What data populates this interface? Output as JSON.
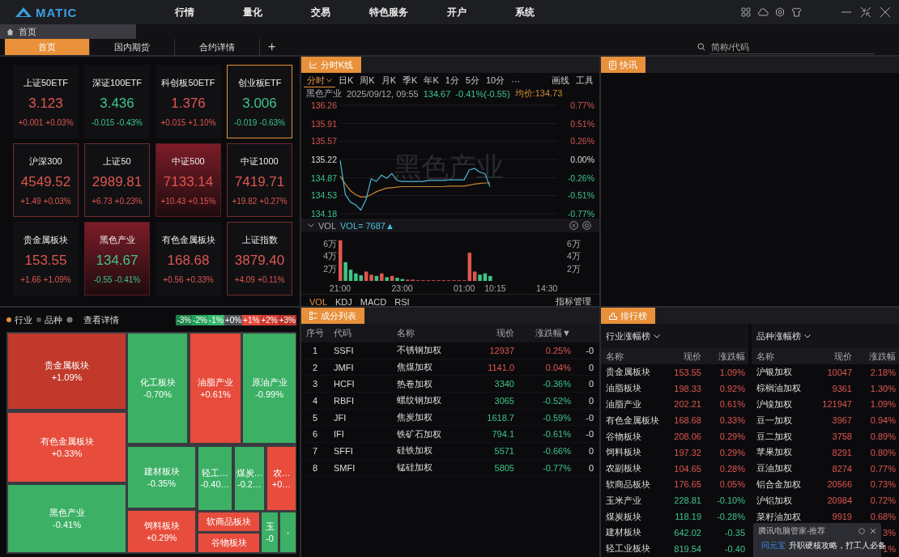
{
  "app": {
    "logo": "MATIC",
    "nav": [
      "行情",
      "量化",
      "交易",
      "特色服务",
      "开户",
      "系统"
    ]
  },
  "breadcrumb": {
    "label": "首页"
  },
  "tabs": [
    {
      "label": "首页",
      "selected": true
    },
    {
      "label": "国内期货",
      "selected": false
    },
    {
      "label": "合约详情",
      "selected": false
    }
  ],
  "add_tab": "+",
  "search": {
    "placeholder": "简称/代码"
  },
  "tiles": [
    {
      "name": "上证50ETF",
      "value": "3.123",
      "change": "+0.001",
      "pct": "+0.03%",
      "rising": true,
      "kind": "plain",
      "selected": false
    },
    {
      "name": "深证100ETF",
      "value": "3.436",
      "change": "-0.015",
      "pct": "-0.43%",
      "rising": false,
      "kind": "plain",
      "selected": false
    },
    {
      "name": "科创板50ETF",
      "value": "1.376",
      "change": "+0.015",
      "pct": "+1.10%",
      "rising": true,
      "kind": "plain",
      "selected": false
    },
    {
      "name": "创业板ETF",
      "value": "3.006",
      "change": "-0.019",
      "pct": "-0.63%",
      "rising": false,
      "kind": "plain",
      "selected": true
    },
    {
      "name": "沪深300",
      "value": "4549.52",
      "change": "+1.49",
      "pct": "+0.03%",
      "rising": true,
      "kind": "outlined",
      "selected": false
    },
    {
      "name": "上证50",
      "value": "2989.81",
      "change": "+6.73",
      "pct": "+0.23%",
      "rising": true,
      "kind": "outlined",
      "selected": false
    },
    {
      "name": "中证500",
      "value": "7133.14",
      "change": "+10.43",
      "pct": "+0.15%",
      "rising": true,
      "kind": "filled",
      "selected": false
    },
    {
      "name": "中证1000",
      "value": "7419.71",
      "change": "+19.82",
      "pct": "+0.27%",
      "rising": true,
      "kind": "outlined",
      "selected": false
    },
    {
      "name": "贵金属板块",
      "value": "153.55",
      "change": "+1.66",
      "pct": "+1.09%",
      "rising": true,
      "kind": "plain",
      "selected": false
    },
    {
      "name": "黑色产业",
      "value": "134.67",
      "change": "-0.55",
      "pct": "-0.41%",
      "rising": false,
      "kind": "filled",
      "selected": false
    },
    {
      "name": "有色金属板块",
      "value": "168.68",
      "change": "+0.56",
      "pct": "+0.33%",
      "rising": true,
      "kind": "plain",
      "selected": false
    },
    {
      "name": "上证指数",
      "value": "3879.40",
      "change": "+4.09",
      "pct": "+0.11%",
      "rising": true,
      "kind": "outlined",
      "selected": false
    }
  ],
  "intraday": {
    "title": "分时K线",
    "periods": [
      {
        "label": "分时",
        "selected": true
      },
      {
        "label": "日K",
        "selected": false
      },
      {
        "label": "周K",
        "selected": false
      },
      {
        "label": "月K",
        "selected": false
      },
      {
        "label": "季K",
        "selected": false
      },
      {
        "label": "年K",
        "selected": false
      },
      {
        "label": "1分",
        "selected": false
      },
      {
        "label": "5分",
        "selected": false
      },
      {
        "label": "10分",
        "selected": false
      },
      {
        "label": "···",
        "selected": false
      }
    ],
    "tools": [
      "画线",
      "工具"
    ],
    "info": {
      "name": "黑色产业",
      "time": "2025/09/12, 09:55",
      "price": "134.67",
      "change": "-0.41%(-0.55)",
      "average": "均价:134.73"
    },
    "watermark": "黑色产业",
    "pct_labels": [
      "0.77%",
      "0.51%",
      "0.26%",
      "0.00%",
      "-0.26%",
      "-0.51%",
      "-0.77%"
    ],
    "chart_data": {
      "type": "line",
      "series": [
        {
          "color": "#4fb8d0",
          "values": [
            135.2,
            134.55,
            134.4,
            134.35,
            134.25,
            134.45,
            134.85,
            134.8,
            134.92,
            134.86,
            134.95,
            134.82,
            134.8,
            134.8,
            134.8,
            134.8,
            134.8,
            134.82,
            134.82,
            134.82,
            134.82,
            134.83,
            134.83,
            134.83,
            134.83,
            135.02,
            135.05,
            134.98,
            134.95,
            134.7
          ]
        },
        {
          "color": "#c98430",
          "values": [
            134.9,
            134.75,
            134.62,
            134.55,
            134.5,
            134.5,
            134.55,
            134.6,
            134.64,
            134.67,
            134.68,
            134.69,
            134.7,
            134.7,
            134.7,
            134.7,
            134.7,
            134.7,
            134.7,
            134.7,
            134.7,
            134.71,
            134.71,
            134.71,
            134.71,
            134.73,
            134.75,
            134.76,
            134.77,
            134.77
          ]
        }
      ],
      "ylim": [
        134.18,
        136.26
      ],
      "grid": true,
      "yticks": [
        136.26,
        135.91,
        135.57,
        135.22,
        134.87,
        134.53,
        134.18
      ]
    },
    "volume": {
      "label": "VOL",
      "reading": "VOL= 7687▲",
      "right_labels": [
        "6万",
        "4万",
        "2万"
      ],
      "chart_data": {
        "type": "bar",
        "categories": [
          "21:00",
          null,
          null,
          null,
          null,
          null,
          null,
          null,
          null,
          null,
          null,
          null,
          "23:00",
          null,
          null,
          null,
          null,
          null,
          null,
          null,
          null,
          null,
          null,
          null,
          "01:00",
          null,
          null,
          null,
          null,
          null,
          "10:15",
          null,
          null,
          null,
          null,
          null,
          null,
          null,
          null,
          null,
          "14:30",
          null,
          null
        ],
        "values": [
          6.5,
          3,
          1.8,
          1.2,
          0.9,
          1.5,
          1,
          0.8,
          1.2,
          0.6,
          0.8,
          0.5,
          0.3,
          0.2,
          0.2,
          0.1,
          0.1,
          0.1,
          0.1,
          0.1,
          0.1,
          0.1,
          0.1,
          0.1,
          0.1,
          4.5,
          1.5,
          1,
          1.2,
          0.8,
          null,
          null,
          null,
          null,
          null,
          null,
          null,
          null,
          null,
          null,
          null,
          null,
          null
        ],
        "ylim": [
          0,
          7
        ],
        "yticks": [
          {
            "value": 6,
            "label": "6万"
          },
          {
            "value": 4,
            "label": "4万"
          },
          {
            "value": 2,
            "label": "2万"
          }
        ]
      }
    },
    "indicators": [
      {
        "label": "VOL",
        "selected": true
      },
      {
        "label": "KDJ",
        "selected": false
      },
      {
        "label": "MACD",
        "selected": false
      },
      {
        "label": "RSI",
        "selected": false
      }
    ],
    "manage": "指标管理"
  },
  "news": {
    "title": "快讯"
  },
  "treemap": {
    "modes": [
      {
        "label": "行业",
        "selected": true
      },
      {
        "label": "品种",
        "selected": false
      }
    ],
    "details": "查看详情",
    "legend": [
      {
        "label": "-3%",
        "color": "#1e8449"
      },
      {
        "label": "-2%",
        "color": "#27a05a"
      },
      {
        "label": "-1%",
        "color": "#35b46a"
      },
      {
        "label": "+0%",
        "color": "#50505a"
      },
      {
        "label": "+1%",
        "color": "#e2473b"
      },
      {
        "label": "+2%",
        "color": "#d03a30"
      },
      {
        "label": "+3%",
        "color": "#b8322a"
      }
    ],
    "cells": [
      {
        "name": "贵金属板块",
        "value": "+1.09%",
        "color": "#c0392b"
      },
      {
        "name": "有色金属板块",
        "value": "+0.33%",
        "color": "#e74c3c"
      },
      {
        "name": "黑色产业",
        "value": "-0.41%",
        "color": "#3cb065"
      },
      {
        "name": "化工板块",
        "value": "-0.70%",
        "color": "#3cb065"
      },
      {
        "name": "油脂产业",
        "value": "+0.61%",
        "color": "#e74c3c"
      },
      {
        "name": "原油产业",
        "value": "-0.99%",
        "color": "#3cb065"
      },
      {
        "name": "建材板块",
        "value": "-0.35%",
        "color": "#3cb065"
      },
      {
        "name": "轻工…",
        "value": "-0.40…",
        "color": "#3cb065"
      },
      {
        "name": "煤炭…",
        "value": "-0.2…",
        "color": "#3cb065"
      },
      {
        "name": "农…",
        "value": "+0…",
        "color": "#e74c3c"
      },
      {
        "name": "饲料板块",
        "value": "+0.29%",
        "color": "#e74c3c"
      },
      {
        "name": "软商品板块",
        "color": "#e74c3c"
      },
      {
        "name": "谷物板块",
        "color": "#e74c3c"
      },
      {
        "name": "玉",
        "value": "-0",
        "color": "#3cb065"
      },
      {
        "value": "-",
        "color": "#3cb065"
      }
    ]
  },
  "constituents": {
    "title": "成分列表",
    "columns": [
      "序号",
      "代码",
      "名称",
      "现价",
      "涨跌幅"
    ],
    "sort_mark": "▼",
    "rows": [
      {
        "no": "1",
        "code": "SSFI",
        "name": "不锈钢加权",
        "price": "12937",
        "change": "0.25%",
        "column_6": "-0",
        "rising": true
      },
      {
        "no": "2",
        "code": "JMFI",
        "name": "焦煤加权",
        "price": "1141.0",
        "change": "0.04%",
        "column_6": "0",
        "rising": true
      },
      {
        "no": "3",
        "code": "HCFI",
        "name": "热卷加权",
        "price": "3340",
        "change": "-0.36%",
        "column_6": "0",
        "rising": false
      },
      {
        "no": "4",
        "code": "RBFI",
        "name": "螺纹钢加权",
        "price": "3065",
        "change": "-0.52%",
        "column_6": "0",
        "rising": false
      },
      {
        "no": "5",
        "code": "JFI",
        "name": "焦炭加权",
        "price": "1618.7",
        "change": "-0.59%",
        "column_6": "-0",
        "rising": false
      },
      {
        "no": "6",
        "code": "IFI",
        "name": "铁矿石加权",
        "price": "794.1",
        "change": "-0.61%",
        "column_6": "-0",
        "rising": false
      },
      {
        "no": "7",
        "code": "SFFI",
        "name": "硅铁加权",
        "price": "5571",
        "change": "-0.66%",
        "column_6": "0",
        "rising": false
      },
      {
        "no": "8",
        "code": "SMFI",
        "name": "锰硅加权",
        "price": "5805",
        "change": "-0.77%",
        "column_6": "0",
        "rising": false
      }
    ]
  },
  "ranking": {
    "title": "排行榜",
    "boards": [
      {
        "title": "行业涨幅榜",
        "columns": [
          "名称",
          "现价",
          "涨跌幅"
        ],
        "rows": [
          {
            "name": "贵金属板块",
            "price": "153.55",
            "change": "1.09%",
            "rising": true
          },
          {
            "name": "油脂板块",
            "price": "198.33",
            "change": "0.92%",
            "rising": true
          },
          {
            "name": "油脂产业",
            "price": "202.21",
            "change": "0.61%",
            "rising": true
          },
          {
            "name": "有色金属板块",
            "price": "168.68",
            "change": "0.33%",
            "rising": true
          },
          {
            "name": "谷物板块",
            "price": "208.06",
            "change": "0.29%",
            "rising": true
          },
          {
            "name": "饲料板块",
            "price": "197.32",
            "change": "0.29%",
            "rising": true
          },
          {
            "name": "农副板块",
            "price": "104.65",
            "change": "0.28%",
            "rising": true
          },
          {
            "name": "软商品板块",
            "price": "176.65",
            "change": "0.05%",
            "rising": true
          },
          {
            "name": "玉米产业",
            "price": "228.81",
            "change": "-0.10%",
            "rising": false
          },
          {
            "name": "煤炭板块",
            "price": "118.19",
            "change": "-0.28%",
            "rising": false
          },
          {
            "name": "建材板块",
            "price": "642.02",
            "change": "-0.35",
            "rising": false
          },
          {
            "name": "轻工业板块",
            "price": "819.54",
            "change": "-0.40",
            "rising": false
          }
        ]
      },
      {
        "title": "品种涨幅榜",
        "columns": [
          "名称",
          "现价",
          "涨跌幅"
        ],
        "rows": [
          {
            "name": "沪银加权",
            "price": "10047",
            "change": "2.18%",
            "rising": true
          },
          {
            "name": "棕榈油加权",
            "price": "9361",
            "change": "1.30%",
            "rising": true
          },
          {
            "name": "沪镍加权",
            "price": "121947",
            "change": "1.09%",
            "rising": true
          },
          {
            "name": "豆一加权",
            "price": "3967",
            "change": "0.94%",
            "rising": true
          },
          {
            "name": "豆二加权",
            "price": "3758",
            "change": "0.89%",
            "rising": true
          },
          {
            "name": "苹果加权",
            "price": "8291",
            "change": "0.80%",
            "rising": true
          },
          {
            "name": "豆油加权",
            "price": "8274",
            "change": "0.77%",
            "rising": true
          },
          {
            "name": "铝合金加权",
            "price": "20566",
            "change": "0.73%",
            "rising": true
          },
          {
            "name": "沪铝加权",
            "price": "20984",
            "change": "0.72%",
            "rising": true
          },
          {
            "name": "菜籽油加权",
            "price": "9919",
            "change": "0.68%",
            "rising": true
          },
          {
            "change": "3%",
            "rising": true
          },
          {
            "change": "1%",
            "rising": true
          }
        ]
      }
    ]
  },
  "popup": {
    "source": "腾讯电脑管家-推荐",
    "brand": "问元宝",
    "message": "升职硬核攻略，打工人必备"
  }
}
